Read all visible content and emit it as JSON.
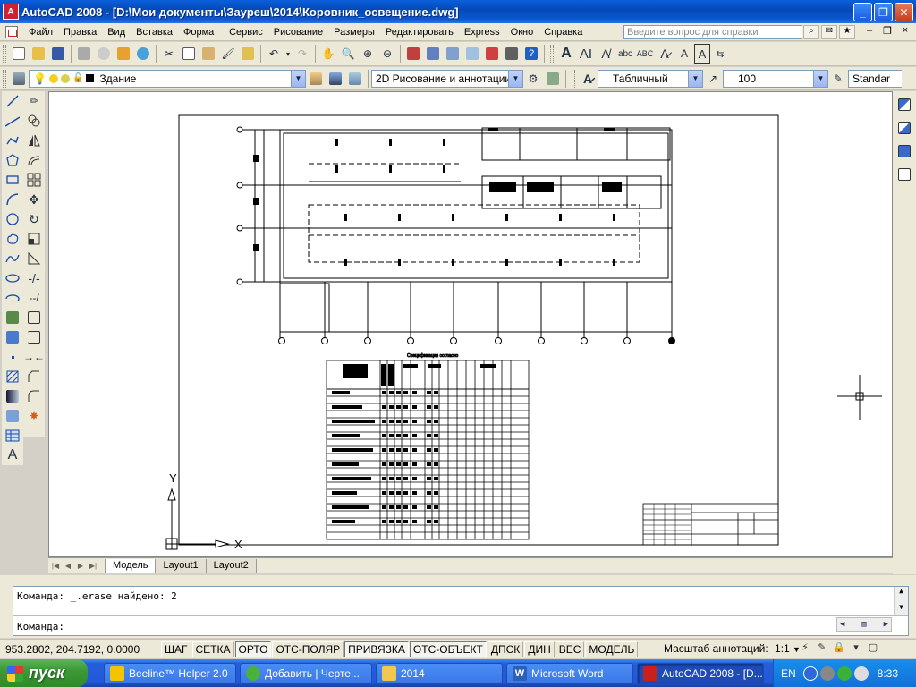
{
  "window": {
    "app_icon": "A",
    "title": "AutoCAD 2008 - [D:\\Мои документы\\Зауреш\\2014\\Коровник_освещение.dwg]",
    "buttons": {
      "minimize": "_",
      "maximize": "❐",
      "close": "✕"
    }
  },
  "menu": {
    "items": [
      "Файл",
      "Правка",
      "Вид",
      "Вставка",
      "Формат",
      "Сервис",
      "Рисование",
      "Размеры",
      "Редактировать",
      "Express",
      "Окно",
      "Справка"
    ],
    "help_search_placeholder": "Введите вопрос для справки",
    "doc_controls": {
      "minimize": "–",
      "restore": "❐",
      "close": "×"
    }
  },
  "toolbar2": {
    "layer_name": "Здание",
    "workspace": "2D Рисование и аннотации",
    "text_style": "Табличный",
    "dim_value": "100",
    "table_style": "Standar"
  },
  "icons": {
    "standard_toolbar": [
      "new-file",
      "open-file",
      "save",
      "print",
      "plot-preview",
      "publish",
      "3d-dwf",
      "cut",
      "copy",
      "paste",
      "match-properties",
      "block-editor",
      "undo",
      "redo",
      "pan",
      "zoom-realtime",
      "zoom-window",
      "zoom-previous",
      "properties",
      "design-center",
      "tool-palettes",
      "sheet-set",
      "markup",
      "quick-calc",
      "help"
    ],
    "text_toolbar": [
      "multiline-text",
      "single-line-text",
      "edit-text",
      "find",
      "spelling",
      "text-style",
      "scale-text",
      "justify-text",
      "convert-space"
    ],
    "draw_toolbar": [
      "line",
      "construction-line",
      "polyline",
      "polygon",
      "rectangle",
      "arc",
      "circle",
      "revision-cloud",
      "spline",
      "ellipse",
      "ellipse-arc",
      "insert-block",
      "make-block",
      "point",
      "hatch",
      "gradient",
      "region",
      "table",
      "multiline-text-draw"
    ],
    "modify_toolbar": [
      "erase",
      "copy-object",
      "mirror",
      "offset",
      "array",
      "move",
      "rotate",
      "scale",
      "stretch",
      "trim",
      "extend",
      "break-at-point",
      "break",
      "join",
      "chamfer",
      "fillet",
      "explode"
    ],
    "right_toolbar": [
      "draw-order-front",
      "draw-order-back",
      "bring-above",
      "send-under"
    ]
  },
  "layout_tabs": [
    "Модель",
    "Layout1",
    "Layout2"
  ],
  "command": {
    "history": "Команда:  _.erase найдено: 2",
    "prompt": "Команда:"
  },
  "status": {
    "coords": "953.2802, 204.7192, 0.0000",
    "toggles": [
      {
        "label": "ШАГ",
        "on": false
      },
      {
        "label": "СЕТКА",
        "on": false
      },
      {
        "label": "ОРТО",
        "on": true
      },
      {
        "label": "ОТС-ПОЛЯР",
        "on": false
      },
      {
        "label": "ПРИВЯЗКА",
        "on": true
      },
      {
        "label": "ОТС-ОБЪЕКТ",
        "on": true
      },
      {
        "label": "ДПСК",
        "on": false
      },
      {
        "label": "ДИН",
        "on": false
      },
      {
        "label": "ВЕС",
        "on": false
      },
      {
        "label": "МОДЕЛЬ",
        "on": false
      }
    ],
    "annotation_scale_label": "Масштаб аннотаций:",
    "annotation_scale_value": "1:1"
  },
  "ucs": {
    "y_label": "Y",
    "x_label": "X"
  },
  "drawing": {
    "axis_top": [
      "1",
      "2",
      "3",
      "4",
      "5",
      "6",
      "7",
      "8",
      "9",
      "10"
    ],
    "axis_left": [
      "Г",
      "В",
      "Б",
      "А"
    ],
    "table_title": "Спецификация согласно"
  },
  "taskbar": {
    "start_label": "пуск",
    "tasks": [
      {
        "label": "Beeline™ Helper 2.0",
        "icon_color": "#f5c400",
        "active": false
      },
      {
        "label": "Добавить | Черте...",
        "icon_color": "#4ab23a",
        "active": false
      },
      {
        "label": "2014",
        "icon_color": "#f0c850",
        "active": false
      },
      {
        "label": "Microsoft Word",
        "icon_color": "#2b5fb8",
        "active": false
      },
      {
        "label": "AutoCAD 2008 - [D...",
        "icon_color": "#c8201a",
        "active": true
      }
    ],
    "language": "EN",
    "clock": "8:33"
  },
  "colors": {
    "title_blue": "#0a56d0",
    "taskbar_blue": "#245edb",
    "start_green": "#3c9a36",
    "drawing_bg": "#ffffff"
  }
}
